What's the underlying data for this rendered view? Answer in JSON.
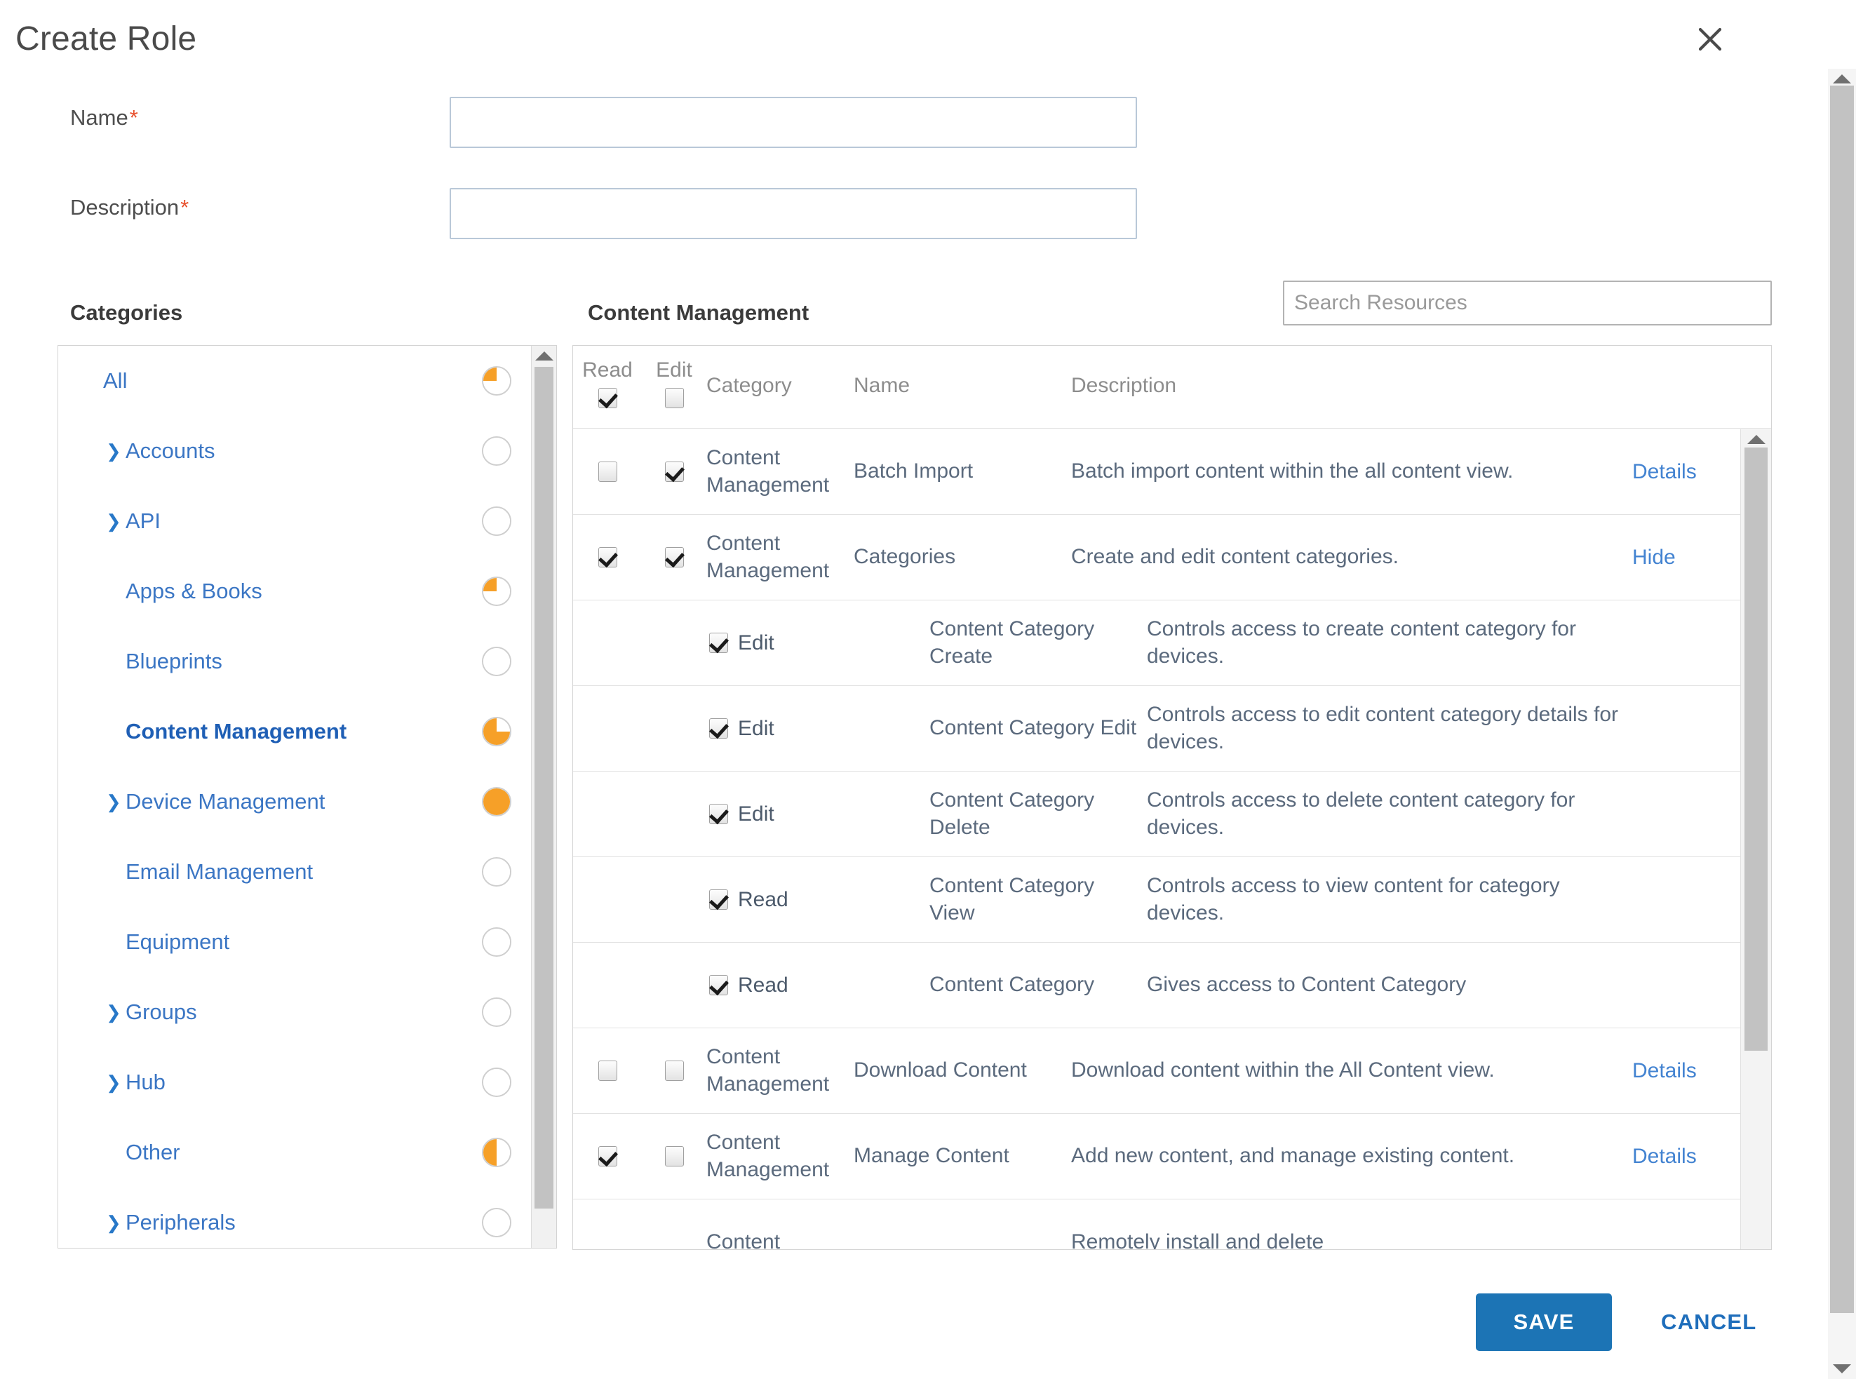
{
  "dialog": {
    "title": "Create Role",
    "close_icon": "close-icon"
  },
  "form": {
    "name_label": "Name",
    "name_value": "",
    "description_label": "Description",
    "description_value": "",
    "required_marker": "*"
  },
  "categories_panel": {
    "heading": "Categories",
    "items": [
      {
        "label": "All",
        "expandable": false,
        "indent": 0,
        "active": false,
        "fill": 25
      },
      {
        "label": "Accounts",
        "expandable": true,
        "indent": 1,
        "active": false,
        "fill": 0
      },
      {
        "label": "API",
        "expandable": true,
        "indent": 1,
        "active": false,
        "fill": 0
      },
      {
        "label": "Apps & Books",
        "expandable": false,
        "indent": 1,
        "active": false,
        "fill": 25
      },
      {
        "label": "Blueprints",
        "expandable": false,
        "indent": 1,
        "active": false,
        "fill": 0
      },
      {
        "label": "Content Management",
        "expandable": false,
        "indent": 1,
        "active": true,
        "fill": 75
      },
      {
        "label": "Device Management",
        "expandable": true,
        "indent": 1,
        "active": false,
        "fill": 100
      },
      {
        "label": "Email Management",
        "expandable": false,
        "indent": 1,
        "active": false,
        "fill": 0
      },
      {
        "label": "Equipment",
        "expandable": false,
        "indent": 1,
        "active": false,
        "fill": 0
      },
      {
        "label": "Groups",
        "expandable": true,
        "indent": 1,
        "active": false,
        "fill": 0
      },
      {
        "label": "Hub",
        "expandable": true,
        "indent": 1,
        "active": false,
        "fill": 0
      },
      {
        "label": "Other",
        "expandable": false,
        "indent": 1,
        "active": false,
        "fill": 50
      },
      {
        "label": "Peripherals",
        "expandable": true,
        "indent": 1,
        "active": false,
        "fill": 0
      }
    ],
    "caret_icon": "chevron-right-icon"
  },
  "resources_panel": {
    "heading": "Content Management",
    "search_placeholder": "Search Resources",
    "search_value": "",
    "columns": {
      "read": "Read",
      "edit": "Edit",
      "category": "Category",
      "name": "Name",
      "description": "Description"
    },
    "header_select_all": {
      "read_checked": true,
      "edit_checked": false
    },
    "rows": [
      {
        "type": "main",
        "read_checked": false,
        "edit_checked": true,
        "category": "Content Management",
        "name": "Batch Import",
        "description": "Batch import content within the all content view.",
        "action": "Details"
      },
      {
        "type": "main",
        "read_checked": true,
        "edit_checked": true,
        "category": "Content Management",
        "name": "Categories",
        "description": "Create and edit content categories.",
        "action": "Hide"
      },
      {
        "type": "sub",
        "perm_checked": true,
        "perm_label": "Edit",
        "name": "Content Category Create",
        "description": "Controls access to create content category for devices.",
        "action": ""
      },
      {
        "type": "sub",
        "perm_checked": true,
        "perm_label": "Edit",
        "name": "Content Category Edit",
        "description": "Controls access to edit content category details for devices.",
        "action": ""
      },
      {
        "type": "sub",
        "perm_checked": true,
        "perm_label": "Edit",
        "name": "Content Category Delete",
        "description": "Controls access to delete content category for devices.",
        "action": ""
      },
      {
        "type": "sub",
        "perm_checked": true,
        "perm_label": "Read",
        "name": "Content Category View",
        "description": "Controls access to view content for category devices.",
        "action": ""
      },
      {
        "type": "sub",
        "perm_checked": true,
        "perm_label": "Read",
        "name": "Content Category",
        "description": "Gives access to Content Category",
        "action": ""
      },
      {
        "type": "main",
        "read_checked": false,
        "edit_checked": false,
        "category": "Content Management",
        "name": "Download Content",
        "description": "Download content within the All Content view.",
        "action": "Details"
      },
      {
        "type": "main",
        "read_checked": true,
        "edit_checked": false,
        "category": "Content Management",
        "name": "Manage Content",
        "description": "Add new content, and manage existing content.",
        "action": "Details"
      },
      {
        "type": "main-partial",
        "read_checked": false,
        "edit_checked": false,
        "category": "Content",
        "name": "",
        "description": "Remotely install and delete",
        "action": ""
      }
    ]
  },
  "footer": {
    "save_label": "SAVE",
    "cancel_label": "CANCEL"
  },
  "colors": {
    "accent_blue": "#1c74b5",
    "link_blue": "#3b76c4",
    "pie_orange": "#f6a028",
    "required_red": "#e8512e"
  }
}
